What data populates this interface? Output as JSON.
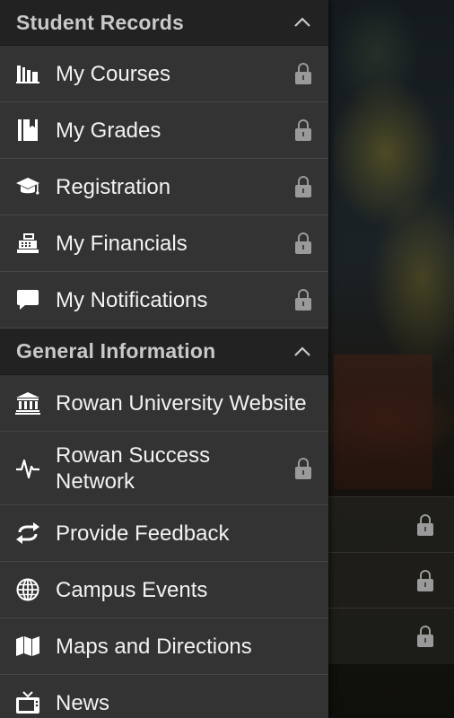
{
  "student_records": {
    "title": "Student Records",
    "items": [
      {
        "label": "My Courses",
        "icon": "books-icon",
        "locked": true
      },
      {
        "label": "My Grades",
        "icon": "notebook-icon",
        "locked": true
      },
      {
        "label": "Registration",
        "icon": "graduation-cap-icon",
        "locked": true
      },
      {
        "label": "My Financials",
        "icon": "cash-register-icon",
        "locked": true
      },
      {
        "label": "My Notifications",
        "icon": "chat-bubble-icon",
        "locked": true
      }
    ]
  },
  "general_information": {
    "title": "General Information",
    "items": [
      {
        "label": "Rowan University Website",
        "icon": "bank-icon",
        "locked": false
      },
      {
        "label": "Rowan Success Network",
        "icon": "pulse-icon",
        "locked": true
      },
      {
        "label": "Provide Feedback",
        "icon": "sync-arrows-icon",
        "locked": false
      },
      {
        "label": "Campus Events",
        "icon": "globe-icon",
        "locked": false
      },
      {
        "label": "Maps and Directions",
        "icon": "map-icon",
        "locked": false
      },
      {
        "label": "News",
        "icon": "tv-icon",
        "locked": false
      }
    ]
  },
  "colors": {
    "drawer_bg": "#333333",
    "header_bg": "#222222",
    "text": "#f2f2f2",
    "header_text": "#c9c9c9",
    "lock": "#9a9a9a"
  }
}
